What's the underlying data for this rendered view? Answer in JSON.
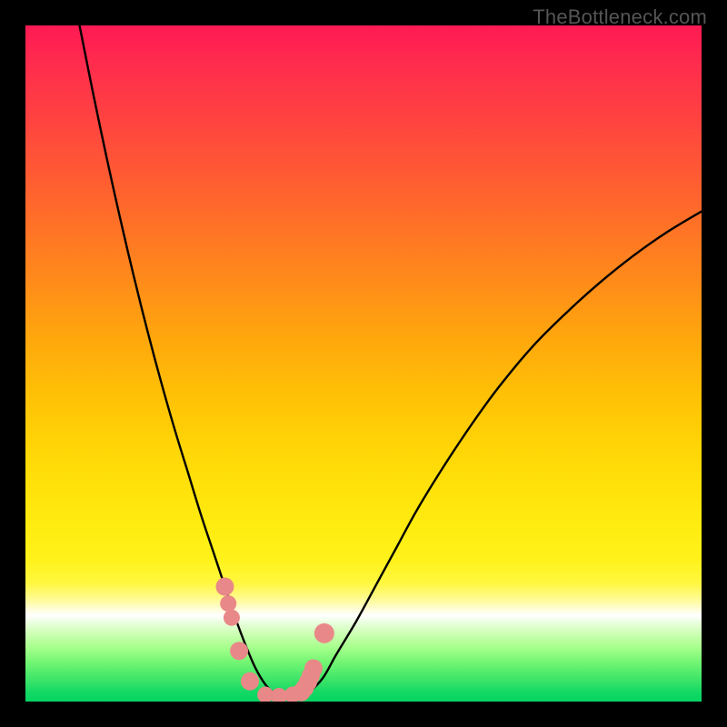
{
  "attribution": "TheBottleneck.com",
  "colors": {
    "curve_stroke": "#000000",
    "marker_fill": "#e98888",
    "frame_background": "#000000"
  },
  "chart_data": {
    "type": "line",
    "title": "",
    "xlabel": "",
    "ylabel": "",
    "xlim": [
      0,
      100
    ],
    "ylim": [
      0,
      100
    ],
    "series": [
      {
        "name": "left-curve",
        "x": [
          8,
          10,
          12,
          14,
          16,
          18,
          20,
          22,
          24,
          26,
          28,
          29.5,
          31,
          32.5,
          34,
          35.5,
          37
        ],
        "values": [
          100,
          90,
          80.5,
          71.5,
          63,
          55,
          47.5,
          40.5,
          34,
          27.5,
          21.5,
          17,
          12.5,
          8.5,
          5,
          2.5,
          1
        ]
      },
      {
        "name": "right-curve",
        "x": [
          40.5,
          42,
          44,
          46,
          49,
          52,
          55,
          58,
          62,
          66,
          70,
          75,
          80,
          85,
          90,
          95,
          100
        ],
        "values": [
          1,
          1.5,
          3.5,
          7,
          12,
          17.5,
          23,
          28.5,
          35,
          41,
          46.5,
          52.5,
          57.5,
          62,
          66,
          69.5,
          72.5
        ]
      }
    ],
    "markers": {
      "name": "highlighted-points",
      "x": [
        29.5,
        30.0,
        30.5,
        31.6,
        33.2,
        35.5,
        37.5,
        39.5,
        40.8,
        41.3,
        41.8,
        42.2,
        42.6,
        44.2
      ],
      "values": [
        17.0,
        14.5,
        12.4,
        7.5,
        3.0,
        1.0,
        0.8,
        1.0,
        1.4,
        2.0,
        2.9,
        3.8,
        4.9,
        10.1
      ],
      "radius": [
        10,
        9,
        9,
        10,
        10,
        9,
        9,
        9,
        10,
        10,
        10,
        10,
        10,
        11
      ]
    }
  }
}
